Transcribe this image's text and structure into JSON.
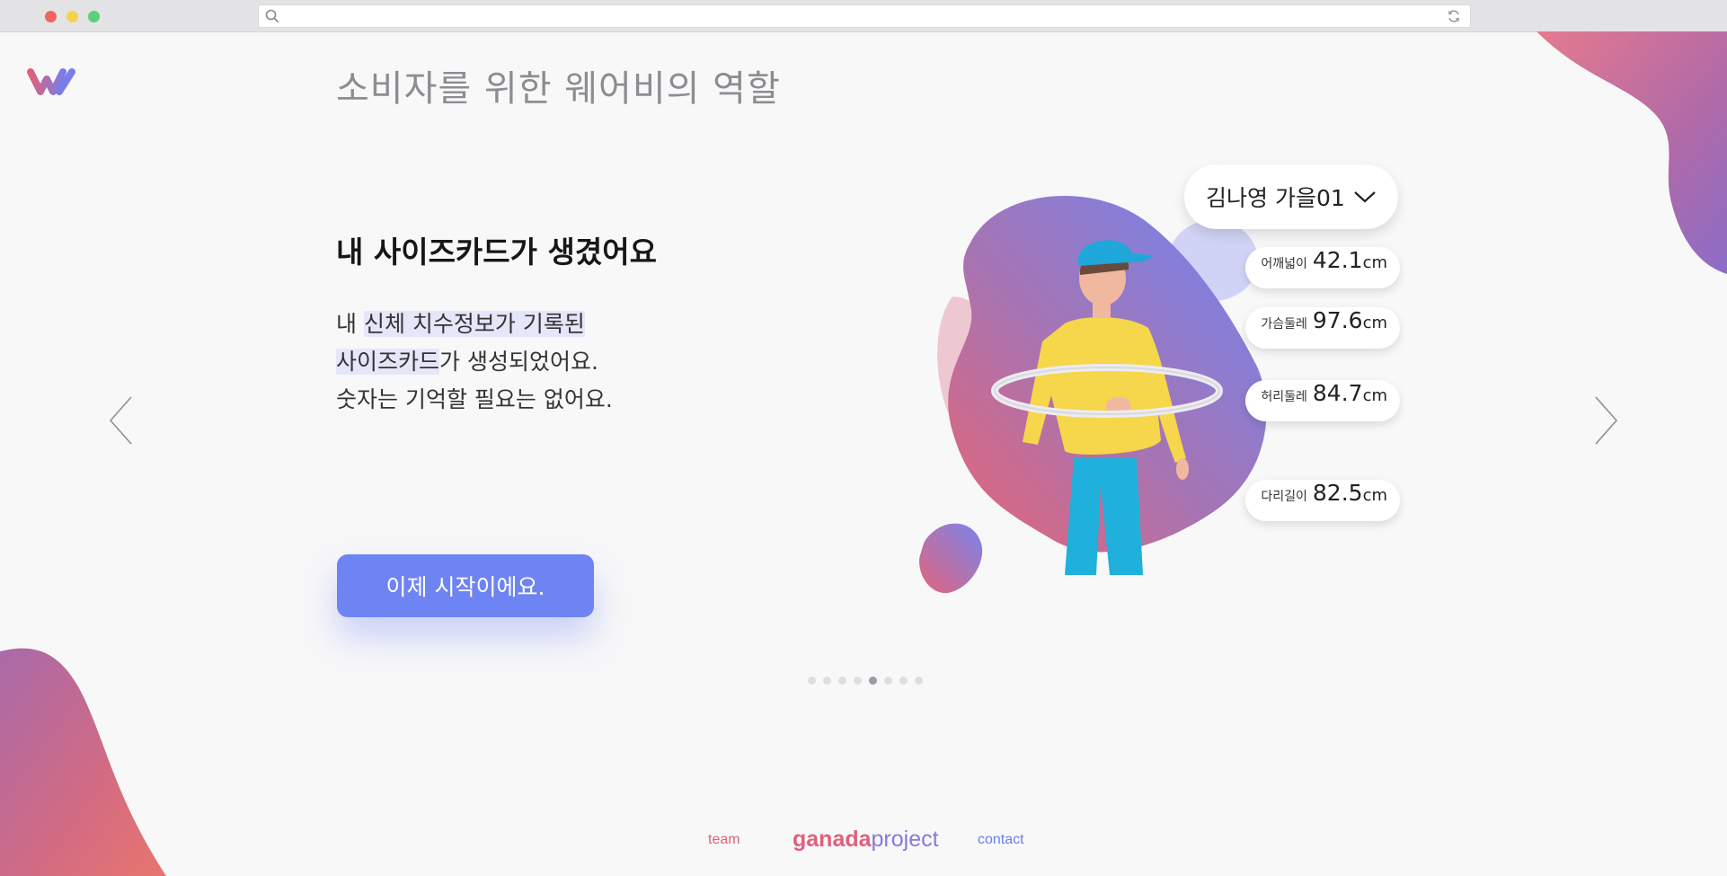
{
  "page": {
    "title": "소비자를 위한 웨어비의 역할",
    "headline": "내 사이즈카드가 생겼어요",
    "body": {
      "line1_plain": "내 ",
      "line1_highlight": "신체 치수정보가 기록된",
      "line2_highlight": "사이즈카드",
      "line2_plain": "가 생성되었어요.",
      "line3": "숫자는 기억할 필요는 없어요."
    },
    "cta_label": "이제 시작이에요."
  },
  "profile": {
    "selected": "김나영 가을01"
  },
  "measurements": [
    {
      "label": "어깨넓이",
      "value": "42.1",
      "unit": "cm"
    },
    {
      "label": "가슴둘레",
      "value": "97.6",
      "unit": "cm"
    },
    {
      "label": "허리둘레",
      "value": "84.7",
      "unit": "cm"
    },
    {
      "label": "다리길이",
      "value": "82.5",
      "unit": "cm"
    }
  ],
  "pagination": {
    "total": 8,
    "active_index": 4
  },
  "footer": {
    "team": "team",
    "brand_bold": "ganada",
    "brand_light": "project",
    "contact": "contact"
  },
  "colors": {
    "accent": "#6f84f3",
    "pink": "#e0607a",
    "purple": "#8a7ad9"
  },
  "icons": {
    "logo": "wearbe-logo",
    "search": "search-icon",
    "reload": "reload-icon",
    "prev": "chevron-left-icon",
    "next": "chevron-right-icon",
    "dropdown": "chevron-down-icon"
  }
}
